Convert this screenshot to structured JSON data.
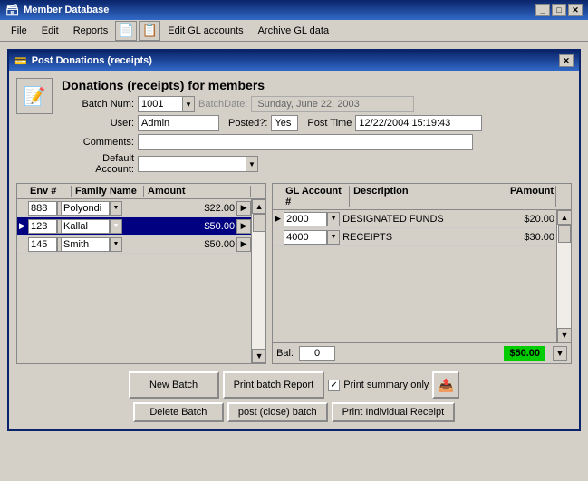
{
  "titlebar": {
    "label": "Member Database",
    "icon": "🗃"
  },
  "menubar": {
    "items": [
      "File",
      "Edit",
      "Reports",
      "Edit GL accounts",
      "Archive GL data"
    ]
  },
  "dialog": {
    "title": "Post Donations (receipts)",
    "header_title": "Donations (receipts) for members",
    "batch_num_label": "Batch Num:",
    "batch_num_value": "1001",
    "batch_date_label": "BatchDate:",
    "batch_date_value": "Sunday, June 22, 2003",
    "user_label": "User:",
    "user_value": "Admin",
    "posted_label": "Posted?:",
    "posted_value": "Yes",
    "post_time_label": "Post Time",
    "post_time_value": "12/22/2004 15:19:43",
    "comments_label": "Comments:",
    "default_account_label": "Default Account:"
  },
  "left_table": {
    "columns": [
      "Env #",
      "Family Name",
      "Amount"
    ],
    "rows": [
      {
        "env": "888",
        "name": "Polyondi",
        "amount": "$22.00",
        "selected": false
      },
      {
        "env": "123",
        "name": "Kallal",
        "amount": "$50.00",
        "selected": true
      },
      {
        "env": "145",
        "name": "Smith",
        "amount": "$50.00",
        "selected": false
      }
    ]
  },
  "right_table": {
    "columns": [
      "GL Account #",
      "Description",
      "PAmount"
    ],
    "rows": [
      {
        "gl": "2000",
        "desc": "DESIGNATED FUNDS",
        "amount": "$20.00",
        "selected": true
      },
      {
        "gl": "4000",
        "desc": "RECEIPTS",
        "amount": "$30.00",
        "selected": false
      }
    ]
  },
  "balance": {
    "label": "Bal:",
    "value": "0",
    "total": "$50.00"
  },
  "buttons": {
    "new_batch": "New Batch",
    "print_batch_report": "Print batch Report",
    "print_summary_only": "Print summary only",
    "delete_batch": "Delete Batch",
    "post_close_batch": "post (close) batch",
    "print_individual": "Print Individual Receipt"
  }
}
